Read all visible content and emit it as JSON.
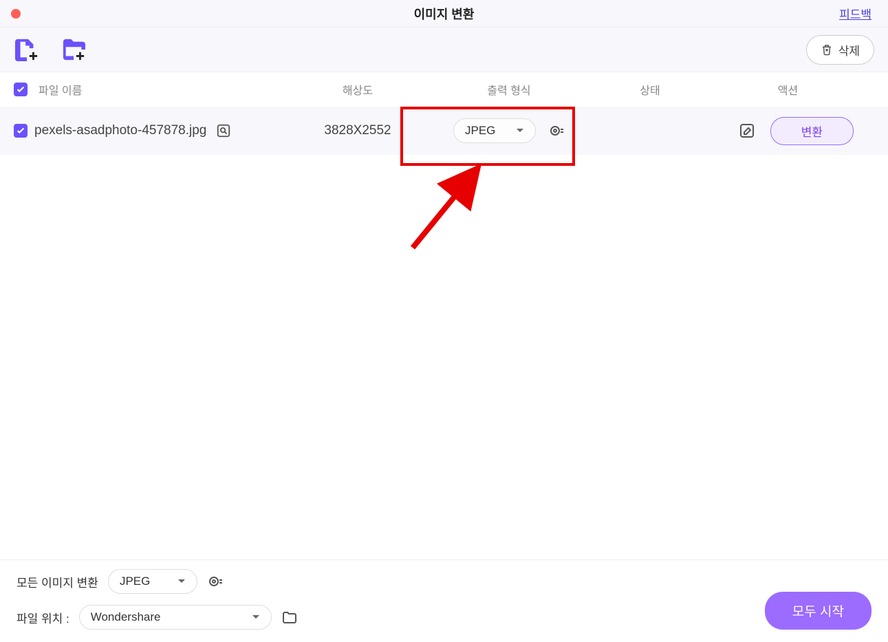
{
  "titlebar": {
    "title": "이미지 변환",
    "feedback": "피드백"
  },
  "toolbar": {
    "delete_label": "삭제"
  },
  "headers": {
    "filename": "파일 이름",
    "resolution": "해상도",
    "output_format": "출력 형식",
    "status": "상태",
    "action": "액션"
  },
  "files": [
    {
      "name": "pexels-asadphoto-457878.jpg",
      "resolution": "3828X2552",
      "format": "JPEG",
      "convert_label": "변환"
    }
  ],
  "footer": {
    "convert_all_label": "모든 이미지 변환",
    "global_format": "JPEG",
    "location_label": "파일 위치 :",
    "location_value": "Wondershare",
    "start_all_label": "모두 시작"
  }
}
